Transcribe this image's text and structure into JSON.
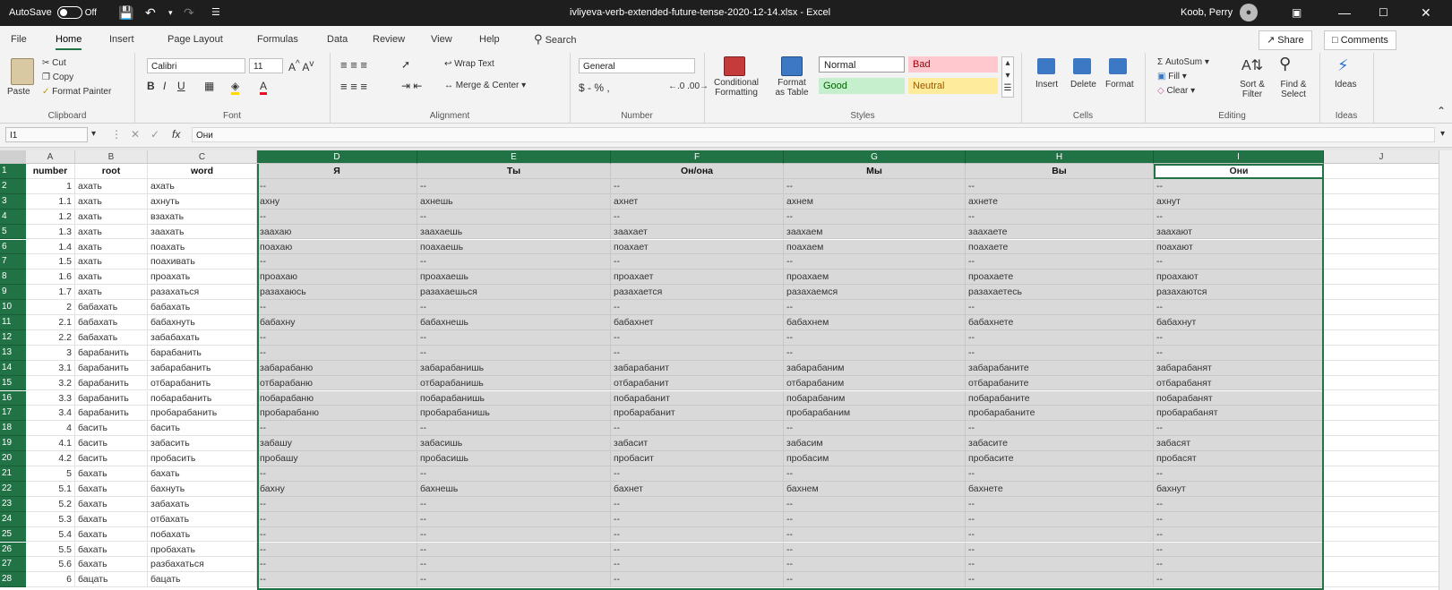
{
  "titlebar": {
    "autosave": "AutoSave",
    "autosave_state": "Off",
    "title": "ivliyeva-verb-extended-future-tense-2020-12-14.xlsx  -  Excel",
    "user": "Koob, Perry"
  },
  "menu": {
    "tabs": [
      "File",
      "Home",
      "Insert",
      "Page Layout",
      "Formulas",
      "Data",
      "Review",
      "View",
      "Help"
    ],
    "search": "Search",
    "share": "Share",
    "comments": "Comments"
  },
  "ribbon": {
    "clipboard": {
      "paste": "Paste",
      "cut": "Cut",
      "copy": "Copy",
      "format_painter": "Format Painter",
      "label": "Clipboard"
    },
    "font": {
      "name": "Calibri",
      "size": "11",
      "label": "Font"
    },
    "alignment": {
      "wrap": "Wrap Text",
      "merge": "Merge & Center",
      "label": "Alignment"
    },
    "number": {
      "format": "General",
      "symbols": "$  -  %  ,",
      "label": "Number"
    },
    "styles": {
      "conditional": "Conditional Formatting",
      "format_table": "Format as Table",
      "normal": "Normal",
      "bad": "Bad",
      "good": "Good",
      "neutral": "Neutral",
      "label": "Styles"
    },
    "cells": {
      "insert": "Insert",
      "delete": "Delete",
      "format": "Format",
      "label": "Cells"
    },
    "editing": {
      "autosum": "AutoSum",
      "fill": "Fill",
      "clear": "Clear",
      "sort": "Sort & Filter",
      "find": "Find & Select",
      "label": "Editing"
    },
    "ideas": {
      "btn": "Ideas",
      "label": "Ideas"
    }
  },
  "formula_bar": {
    "name_box": "I1",
    "fx": "fx",
    "content": "Они"
  },
  "grid": {
    "col_letters": [
      "A",
      "B",
      "C",
      "D",
      "E",
      "F",
      "G",
      "H",
      "I",
      "J"
    ],
    "rows": [
      [
        "number",
        "root",
        "word",
        "Я",
        "Ты",
        "Он/она",
        "Мы",
        "Вы",
        "Они"
      ],
      [
        "1",
        "ахать",
        "ахать",
        "--",
        "--",
        "--",
        "--",
        "--",
        "--"
      ],
      [
        "1.1",
        "ахать",
        "ахнуть",
        "ахну",
        "ахнешь",
        "ахнет",
        "ахнем",
        "ахнете",
        "ахнут"
      ],
      [
        "1.2",
        "ахать",
        "взахать",
        "--",
        "--",
        "--",
        "--",
        "--",
        "--"
      ],
      [
        "1.3",
        "ахать",
        "заахать",
        "заахаю",
        "заахаешь",
        "заахает",
        "заахаем",
        "заахаете",
        "заахают"
      ],
      [
        "1.4",
        "ахать",
        "поахать",
        "поахаю",
        "поахаешь",
        "поахает",
        "поахаем",
        "поахаете",
        "поахают"
      ],
      [
        "1.5",
        "ахать",
        "поахивать",
        "--",
        "--",
        "--",
        "--",
        "--",
        "--"
      ],
      [
        "1.6",
        "ахать",
        "проахать",
        "проахаю",
        "проахаешь",
        "проахает",
        "проахаем",
        "проахаете",
        "проахают"
      ],
      [
        "1.7",
        "ахать",
        "разахаться",
        "разахаюсь",
        "разахаешься",
        "разахается",
        "разахаемся",
        "разахаетесь",
        "разахаются"
      ],
      [
        "2",
        "бабахать",
        "бабахать",
        "--",
        "--",
        "--",
        "--",
        "--",
        "--"
      ],
      [
        "2.1",
        "бабахать",
        "бабахнуть",
        "бабахну",
        "бабахнешь",
        "бабахнет",
        "бабахнем",
        "бабахнете",
        "бабахнут"
      ],
      [
        "2.2",
        "бабахать",
        "забабахать",
        "--",
        "--",
        "--",
        "--",
        "--",
        "--"
      ],
      [
        "3",
        "барабанить",
        "барабанить",
        "--",
        "--",
        "--",
        "--",
        "--",
        "--"
      ],
      [
        "3.1",
        "барабанить",
        "забарабанить",
        "забарабаню",
        "забарабанишь",
        "забарабанит",
        "забарабаним",
        "забарабаните",
        "забарабанят"
      ],
      [
        "3.2",
        "барабанить",
        "отбарабанить",
        "отбарабаню",
        "отбарабанишь",
        "отбарабанит",
        "отбарабаним",
        "отбарабаните",
        "отбарабанят"
      ],
      [
        "3.3",
        "барабанить",
        "побарабанить",
        "побарабаню",
        "побарабанишь",
        "побарабанит",
        "побарабаним",
        "побарабаните",
        "побарабанят"
      ],
      [
        "3.4",
        "барабанить",
        "пробарабанить",
        "пробарабаню",
        "пробарабанишь",
        "пробарабанит",
        "пробарабаним",
        "пробарабаните",
        "пробарабанят"
      ],
      [
        "4",
        "басить",
        "басить",
        "--",
        "--",
        "--",
        "--",
        "--",
        "--"
      ],
      [
        "4.1",
        "басить",
        "забасить",
        "забашу",
        "забасишь",
        "забасит",
        "забасим",
        "забасите",
        "забасят"
      ],
      [
        "4.2",
        "басить",
        "пробасить",
        "пробашу",
        "пробасишь",
        "пробасит",
        "пробасим",
        "пробасите",
        "пробасят"
      ],
      [
        "5",
        "бахать",
        "бахать",
        "--",
        "--",
        "--",
        "--",
        "--",
        "--"
      ],
      [
        "5.1",
        "бахать",
        "бахнуть",
        "бахну",
        "бахнешь",
        "бахнет",
        "бахнем",
        "бахнете",
        "бахнут"
      ],
      [
        "5.2",
        "бахать",
        "забахать",
        "--",
        "--",
        "--",
        "--",
        "--",
        "--"
      ],
      [
        "5.3",
        "бахать",
        "отбахать",
        "--",
        "--",
        "--",
        "--",
        "--",
        "--"
      ],
      [
        "5.4",
        "бахать",
        "побахать",
        "--",
        "--",
        "--",
        "--",
        "--",
        "--"
      ],
      [
        "5.5",
        "бахать",
        "пробахать",
        "--",
        "--",
        "--",
        "--",
        "--",
        "--"
      ],
      [
        "5.6",
        "бахать",
        "разбахаться",
        "--",
        "--",
        "--",
        "--",
        "--",
        "--"
      ],
      [
        "6",
        "бацать",
        "бацать",
        "--",
        "--",
        "--",
        "--",
        "--",
        "--"
      ]
    ]
  },
  "colors": {
    "accent": "#217346",
    "titlebar": "#1e1e1e",
    "selection": "#d9d9d9"
  }
}
